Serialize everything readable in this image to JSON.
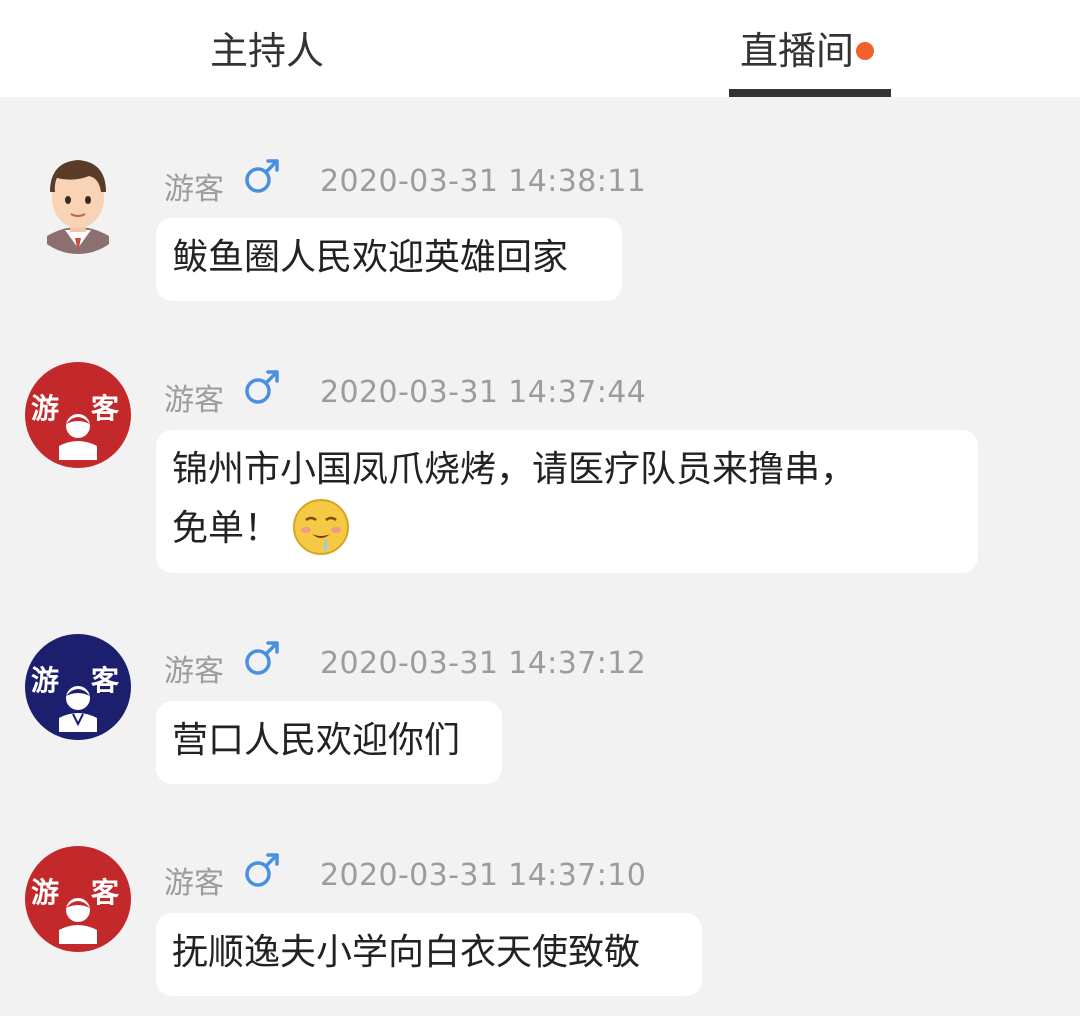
{
  "tabs": {
    "host_label": "主持人",
    "live_label": "直播间",
    "live_active": true,
    "live_dot_color": "#f2602b"
  },
  "messages": [
    {
      "avatar": "man-avatar-icon",
      "name": "游客",
      "gender_icon": "male-icon",
      "time": "2020-03-31 14:38:11",
      "text": "鲅鱼圈人民欢迎英雄回家"
    },
    {
      "avatar": "guest-avatar-red",
      "avatar_text_left": "游",
      "avatar_text_right": "客",
      "name": "游客",
      "gender_icon": "male-icon",
      "time": "2020-03-31 14:37:44",
      "text_line1": "锦州市小国凤爪烧烤，请医疗队员来撸串，",
      "text_line2": "免单！",
      "emoji": "drooling-face-emoji"
    },
    {
      "avatar": "guest-avatar-navy",
      "avatar_text_left": "游",
      "avatar_text_right": "客",
      "name": "游客",
      "gender_icon": "male-icon",
      "time": "2020-03-31 14:37:12",
      "text": "营口人民欢迎你们"
    },
    {
      "avatar": "guest-avatar-red",
      "avatar_text_left": "游",
      "avatar_text_right": "客",
      "name": "游客",
      "gender_icon": "male-icon",
      "time": "2020-03-31 14:37:10",
      "text": "抚顺逸夫小学向白衣天使致敬"
    }
  ],
  "colors": {
    "background": "#f2f2f2",
    "meta_text": "#9c9c9c",
    "male_icon": "#4a90e2",
    "avatar_red": "#c3282b",
    "avatar_navy": "#1b1f6e"
  }
}
